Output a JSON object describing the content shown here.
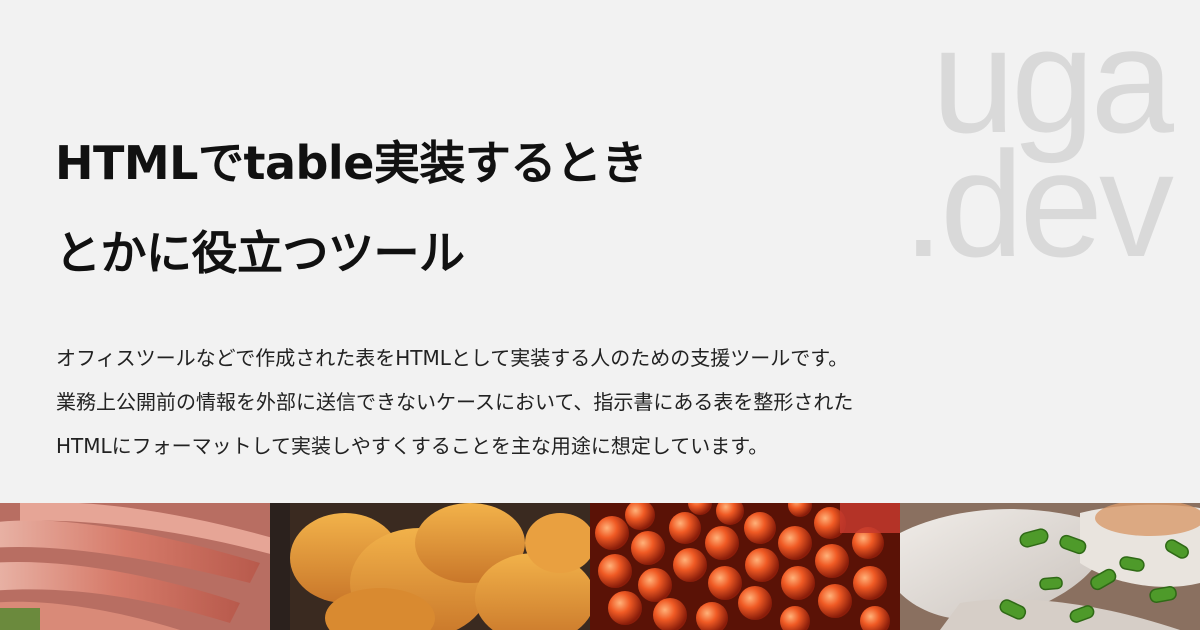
{
  "watermark": {
    "line1": "uga",
    "line2": ".dev"
  },
  "title": {
    "line1": "HTMLでtable実装するとき",
    "line2": "とかに役立つツール"
  },
  "description": {
    "line1": "オフィスツールなどで作成された表をHTMLとして実装する人のための支援ツールです。",
    "line2": "業務上公開前の情報を外部に送信できないケースにおいて、指示書にある表を整形された",
    "line3": "HTMLにフォーマットして実装しやすくすることを主な用途に想定しています。"
  },
  "colors": {
    "background": "#f2f2f2",
    "title": "#111111",
    "text": "#222222",
    "watermark": "#d9d9d9"
  }
}
